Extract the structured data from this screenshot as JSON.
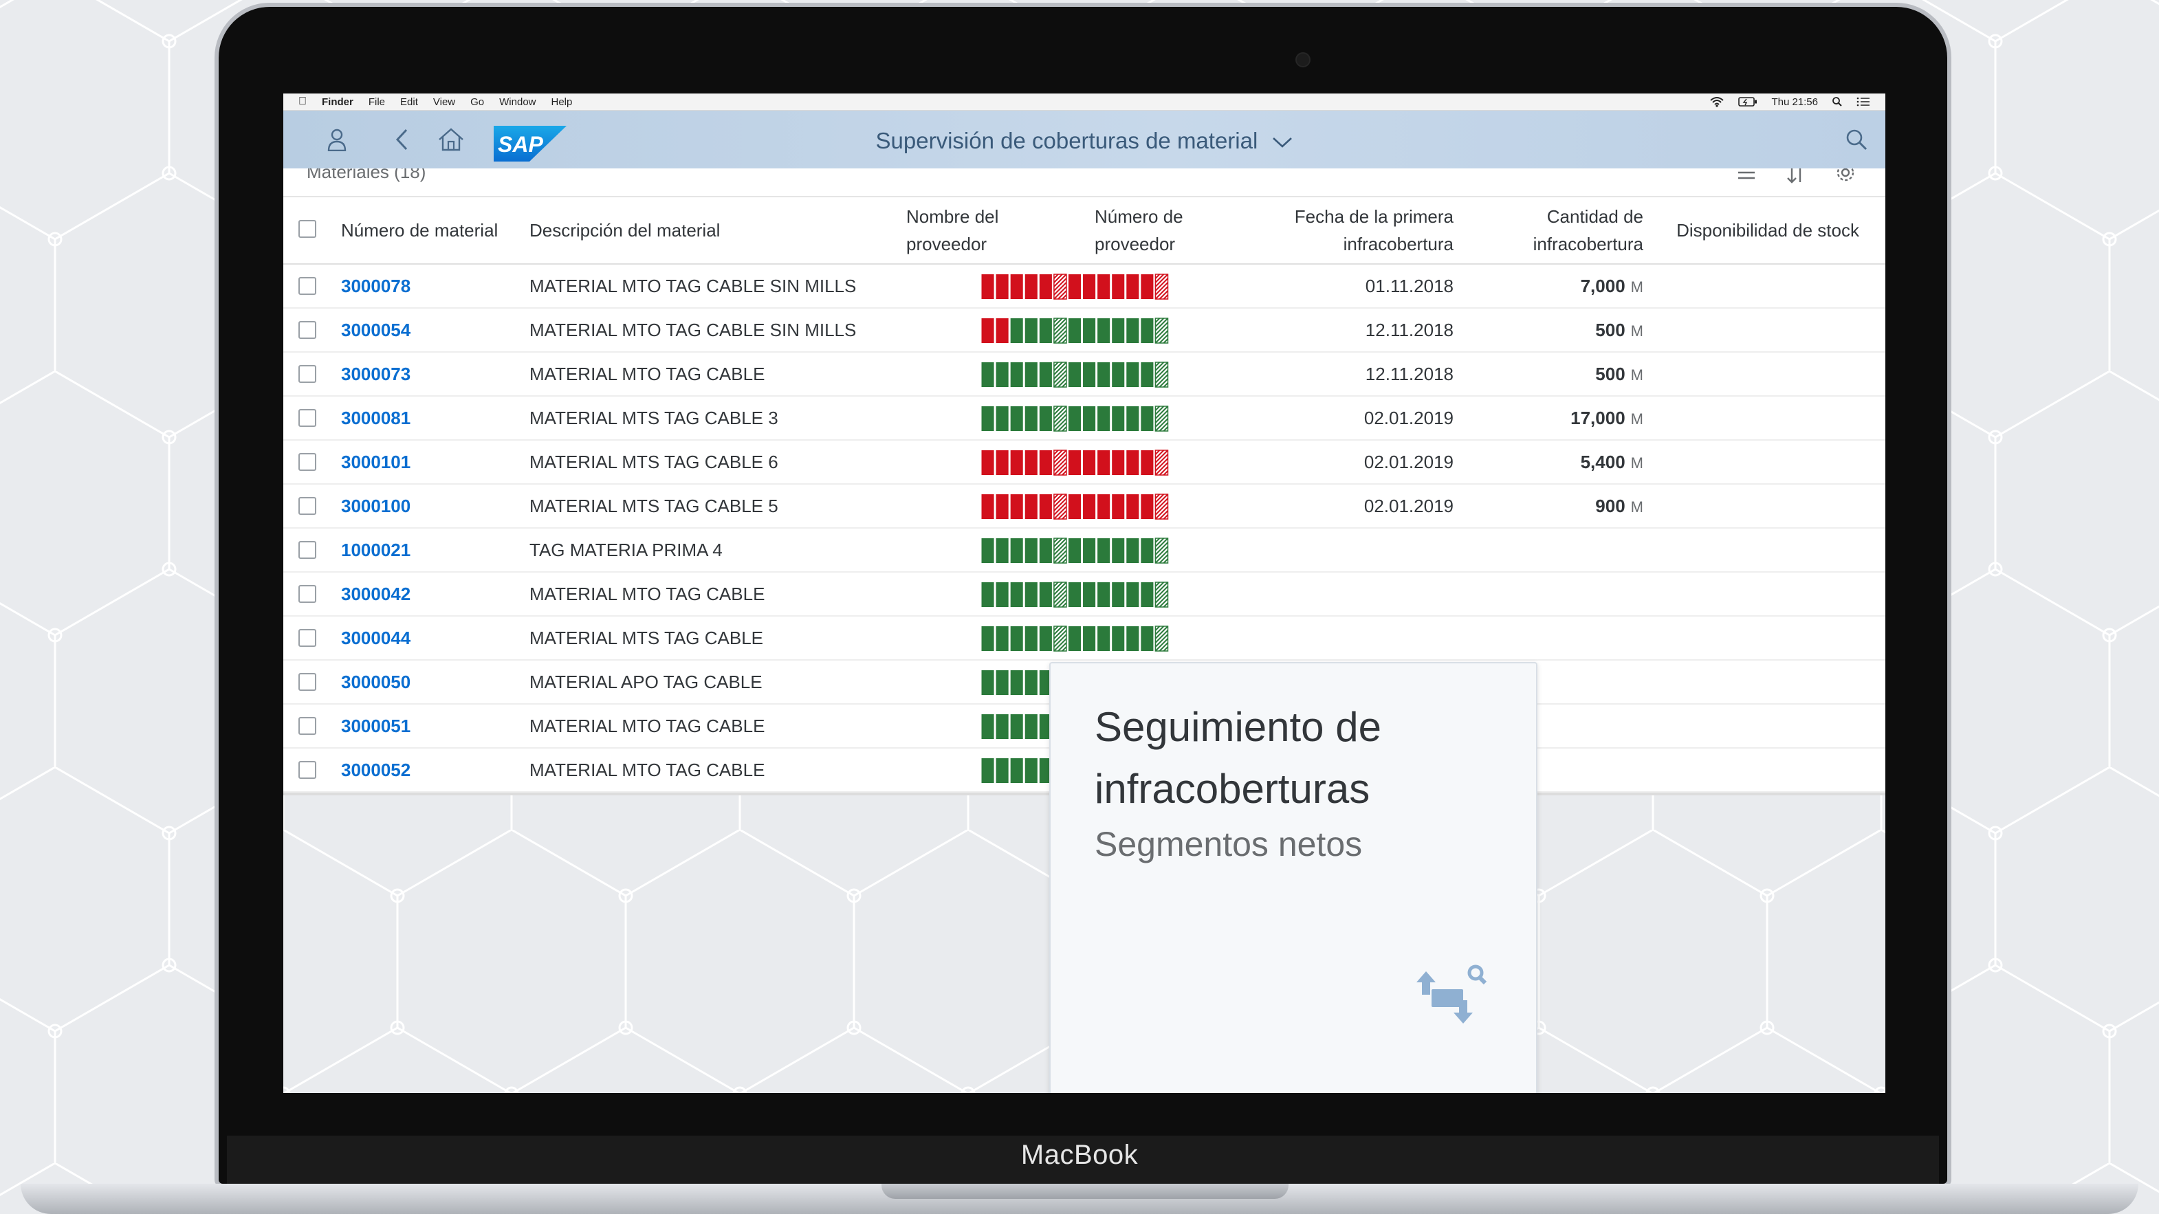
{
  "mac_menubar": {
    "apple_icon": "",
    "app_name": "Finder",
    "items": [
      "File",
      "Edit",
      "View",
      "Go",
      "Window",
      "Help"
    ],
    "clock": "Thu 21:56"
  },
  "shell": {
    "title": "Supervisión de coberturas de material",
    "logo_text": "SAP"
  },
  "table_toolbar": {
    "title": "Materiales (18)"
  },
  "table": {
    "columns": {
      "material_number": "Número de material",
      "description": "Descripción del material",
      "supplier_name_1": "Nombre del",
      "supplier_name_2": "proveedor",
      "supplier_number_1": "Número de",
      "supplier_number_2": "proveedor",
      "first_shortage_date_1": "Fecha de la primera",
      "first_shortage_date_2": "infracobertura",
      "shortage_qty_1": "Cantidad de",
      "shortage_qty_2": "infracobertura",
      "stock_availability": "Disponibilidad de stock"
    },
    "rows": [
      {
        "num": "3000078",
        "desc": "MATERIAL MTO TAG CABLE SIN MILLS",
        "date": "01.11.2018",
        "qty": "7,000",
        "unit": "M",
        "bar": "rrrrrRrrrrrrR"
      },
      {
        "num": "3000054",
        "desc": "MATERIAL MTO TAG CABLE SIN MILLS",
        "date": "12.11.2018",
        "qty": "500",
        "unit": "M",
        "bar": "rrgggGggggggG"
      },
      {
        "num": "3000073",
        "desc": "MATERIAL MTO TAG CABLE",
        "date": "12.11.2018",
        "qty": "500",
        "unit": "M",
        "bar": "gggggGggggggG"
      },
      {
        "num": "3000081",
        "desc": "MATERIAL MTS TAG CABLE 3",
        "date": "02.01.2019",
        "qty": "17,000",
        "unit": "M",
        "bar": "gggggGggggggG"
      },
      {
        "num": "3000101",
        "desc": "MATERIAL MTS TAG CABLE 6",
        "date": "02.01.2019",
        "qty": "5,400",
        "unit": "M",
        "bar": "rrrrrRrrrrrrR"
      },
      {
        "num": "3000100",
        "desc": "MATERIAL MTS TAG CABLE 5",
        "date": "02.01.2019",
        "qty": "900",
        "unit": "M",
        "bar": "rrrrrRrrrrrrR"
      },
      {
        "num": "1000021",
        "desc": "TAG MATERIA PRIMA 4",
        "date": "",
        "qty": "",
        "unit": "",
        "bar": "gggggGggggggG"
      },
      {
        "num": "3000042",
        "desc": "MATERIAL MTO TAG CABLE",
        "date": "",
        "qty": "",
        "unit": "",
        "bar": "gggggGggggggG"
      },
      {
        "num": "3000044",
        "desc": "MATERIAL MTS TAG CABLE",
        "date": "",
        "qty": "",
        "unit": "",
        "bar": "gggggGggggggG"
      },
      {
        "num": "3000050",
        "desc": "MATERIAL APO TAG CABLE",
        "date": "",
        "qty": "",
        "unit": "",
        "bar": "gggggGggggggG"
      },
      {
        "num": "3000051",
        "desc": "MATERIAL MTO TAG CABLE",
        "date": "",
        "qty": "",
        "unit": "",
        "bar": "gggggGggggggG"
      },
      {
        "num": "3000052",
        "desc": "MATERIAL MTO TAG CABLE",
        "date": "",
        "qty": "",
        "unit": "",
        "bar": "gggggGggggggG"
      }
    ]
  },
  "tile": {
    "title": "Seguimiento de infracoberturas",
    "subtitle": "Segmentos netos",
    "icon": "shortage-tracking-icon"
  },
  "device": {
    "brand": "MacBook"
  },
  "colors": {
    "link": "#0a6ed1",
    "stock_red": "#d2101c",
    "stock_green": "#2b7a3b",
    "shell_bg": "#c3d5e8"
  }
}
